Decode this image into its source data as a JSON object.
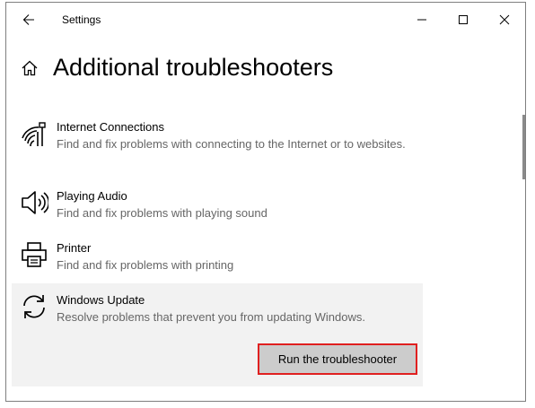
{
  "window": {
    "app_title": "Settings",
    "controls": [
      "minimize-icon",
      "maximize-icon",
      "close-icon"
    ]
  },
  "page": {
    "title": "Additional troubleshooters",
    "home_icon": "home-icon"
  },
  "troubleshooters": [
    {
      "icon": "wifi-icon",
      "title": "Internet Connections",
      "description": "Find and fix problems with connecting to the Internet or to websites."
    },
    {
      "icon": "speaker-icon",
      "title": "Playing Audio",
      "description": "Find and fix problems with playing sound"
    },
    {
      "icon": "printer-icon",
      "title": "Printer",
      "description": "Find and fix problems with printing"
    },
    {
      "icon": "sync-icon",
      "title": "Windows Update",
      "description": "Resolve problems that prevent you from updating Windows.",
      "action_label": "Run the troubleshooter",
      "selected": true
    }
  ],
  "colors": {
    "highlight_border": "#e02020",
    "selected_bg": "#f2f2f2",
    "button_bg": "#cccccc"
  }
}
